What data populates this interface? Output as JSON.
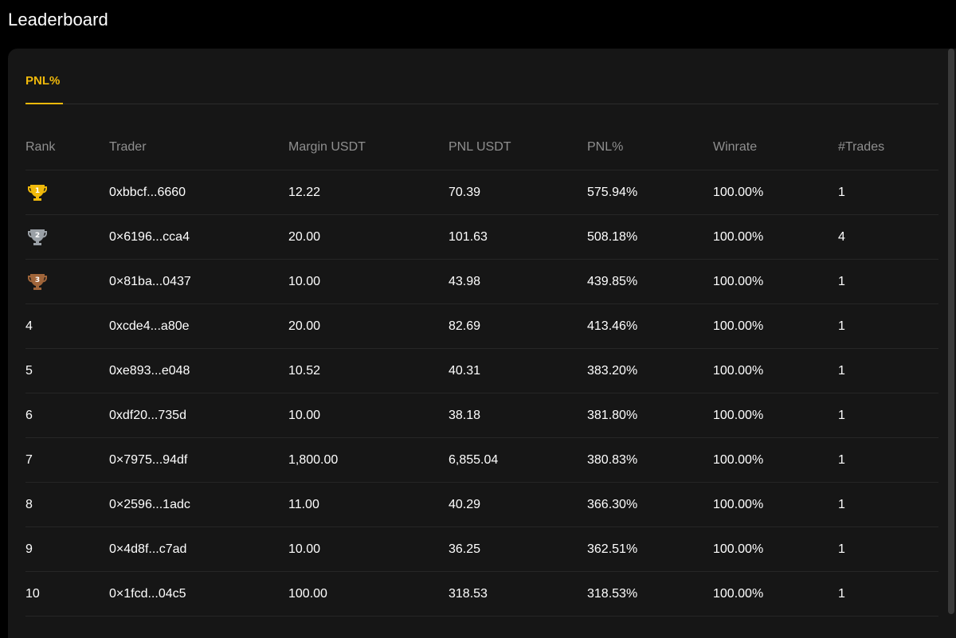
{
  "page": {
    "title": "Leaderboard"
  },
  "tabs": [
    {
      "label": "PNL%",
      "active": true
    }
  ],
  "colors": {
    "accent": "#f0b90b",
    "gold": "#f0b90b",
    "silver": "#9aa0a6",
    "bronze": "#a0653a"
  },
  "table": {
    "headers": {
      "rank": "Rank",
      "trader": "Trader",
      "margin": "Margin USDT",
      "pnl": "PNL USDT",
      "pnl_pct": "PNL%",
      "winrate": "Winrate",
      "trades": "#Trades"
    },
    "rows": [
      {
        "rank": "1",
        "trophy": "gold-trophy-icon",
        "trader": "0xbbcf...6660",
        "margin": "12.22",
        "pnl": "70.39",
        "pnl_pct": "575.94%",
        "winrate": "100.00%",
        "trades": "1"
      },
      {
        "rank": "2",
        "trophy": "silver-trophy-icon",
        "trader": "0×6196...cca4",
        "margin": "20.00",
        "pnl": "101.63",
        "pnl_pct": "508.18%",
        "winrate": "100.00%",
        "trades": "4"
      },
      {
        "rank": "3",
        "trophy": "bronze-trophy-icon",
        "trader": "0×81ba...0437",
        "margin": "10.00",
        "pnl": "43.98",
        "pnl_pct": "439.85%",
        "winrate": "100.00%",
        "trades": "1"
      },
      {
        "rank": "4",
        "trader": "0xcde4...a80e",
        "margin": "20.00",
        "pnl": "82.69",
        "pnl_pct": "413.46%",
        "winrate": "100.00%",
        "trades": "1"
      },
      {
        "rank": "5",
        "trader": "0xe893...e048",
        "margin": "10.52",
        "pnl": "40.31",
        "pnl_pct": "383.20%",
        "winrate": "100.00%",
        "trades": "1"
      },
      {
        "rank": "6",
        "trader": "0xdf20...735d",
        "margin": "10.00",
        "pnl": "38.18",
        "pnl_pct": "381.80%",
        "winrate": "100.00%",
        "trades": "1"
      },
      {
        "rank": "7",
        "trader": "0×7975...94df",
        "margin": "1,800.00",
        "pnl": "6,855.04",
        "pnl_pct": "380.83%",
        "winrate": "100.00%",
        "trades": "1"
      },
      {
        "rank": "8",
        "trader": "0×2596...1adc",
        "margin": "11.00",
        "pnl": "40.29",
        "pnl_pct": "366.30%",
        "winrate": "100.00%",
        "trades": "1"
      },
      {
        "rank": "9",
        "trader": "0×4d8f...c7ad",
        "margin": "10.00",
        "pnl": "36.25",
        "pnl_pct": "362.51%",
        "winrate": "100.00%",
        "trades": "1"
      },
      {
        "rank": "10",
        "trader": "0×1fcd...04c5",
        "margin": "100.00",
        "pnl": "318.53",
        "pnl_pct": "318.53%",
        "winrate": "100.00%",
        "trades": "1"
      }
    ]
  }
}
